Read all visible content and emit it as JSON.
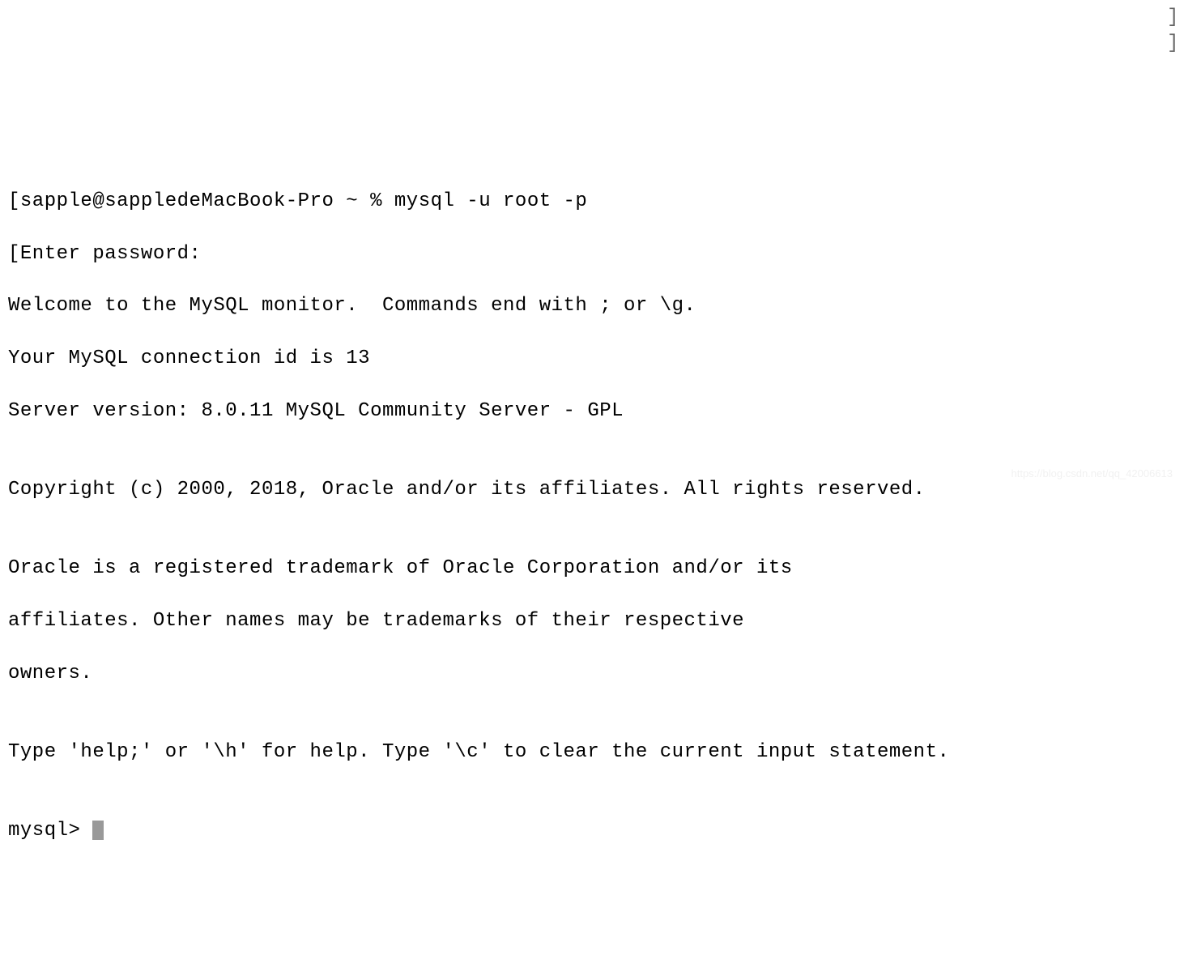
{
  "terminal": {
    "lines": {
      "l0_bracket_open": "[",
      "l0_prompt": "sapple@sappledeMacBook-Pro ~ % ",
      "l0_command": "mysql -u root -p",
      "l1_bracket_open": "[",
      "l1_text": "Enter password: ",
      "l2": "Welcome to the MySQL monitor.  Commands end with ; or \\g.",
      "l3": "Your MySQL connection id is 13",
      "l4": "Server version: 8.0.11 MySQL Community Server - GPL",
      "l5": "",
      "l6": "Copyright (c) 2000, 2018, Oracle and/or its affiliates. All rights reserved.",
      "l7": "",
      "l8": "Oracle is a registered trademark of Oracle Corporation and/or its",
      "l9": "affiliates. Other names may be trademarks of their respective",
      "l10": "owners.",
      "l11": "",
      "l12": "Type 'help;' or '\\h' for help. Type '\\c' to clear the current input statement.",
      "l13": "",
      "l14_prompt": "mysql> "
    },
    "right_bracket": "]"
  },
  "watermark": "https://blog.csdn.net/qq_42006613"
}
